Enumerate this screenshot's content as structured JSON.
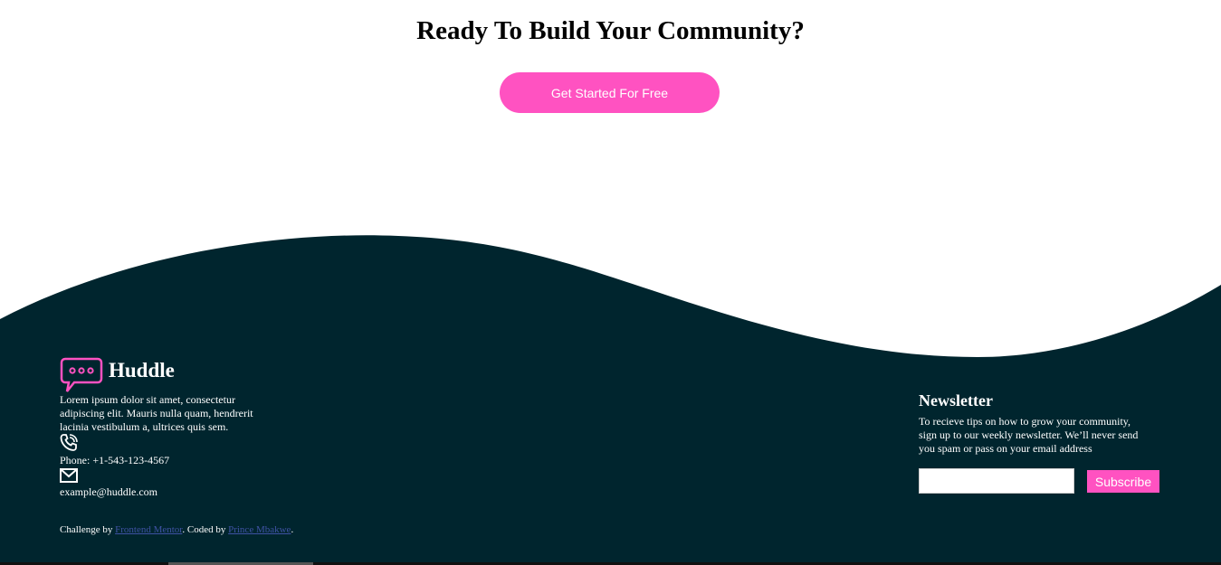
{
  "cta": {
    "title": "Ready To Build Your Community?",
    "button_label": "Get Started For Free"
  },
  "footer": {
    "brand_name": "Huddle",
    "about": "Lorem ipsum dolor sit amet, consectetur adipiscing elit. Mauris nulla quam, hendrerit lacinia vestibulum a, ultrices quis sem.",
    "phone": "Phone: +1-543-123-4567",
    "email": "example@huddle.com",
    "credit": {
      "prefix": "Challenge by ",
      "link1": "Frontend Mentor",
      "middle": ". Coded by ",
      "link2": "Prince Mbakwe",
      "suffix": "."
    },
    "newsletter": {
      "title": "Newsletter",
      "text": "To recieve tips on how to grow your community, sign up to our weekly newsletter. We’ll never send you spam or pass on your email address",
      "input_value": "",
      "button_label": "Subscribe"
    }
  },
  "icons": {
    "logo": "chat-bubble-icon",
    "phone": "phone-icon",
    "email": "mail-icon"
  },
  "colors": {
    "accent": "#ff52c1",
    "footer_bg": "#00252e",
    "link": "#3e52a3"
  }
}
